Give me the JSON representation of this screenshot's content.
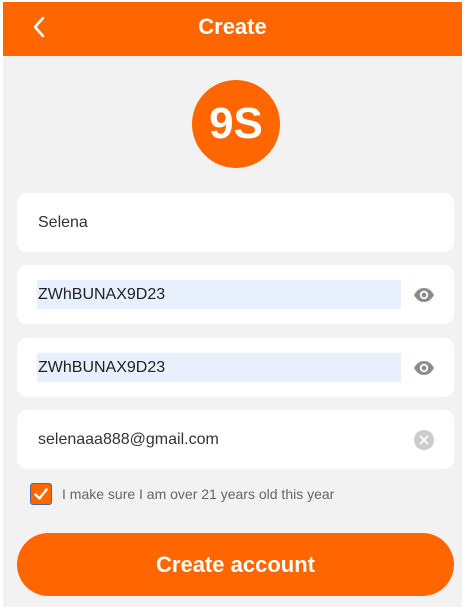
{
  "header": {
    "title": "Create",
    "back_icon": "chevron-left-icon"
  },
  "logo": {
    "text": "9S"
  },
  "form": {
    "username": "Selena",
    "password": "ZWhBUNAX9D23",
    "confirm_password": "ZWhBUNAX9D23",
    "email": "selenaaa888@gmail.com",
    "agree_checked": true,
    "agree_label": "I make sure I am over 21 years old this year"
  },
  "actions": {
    "create_label": "Create account"
  },
  "colors": {
    "accent": "#ff6600",
    "background": "#f2f2f2",
    "autofill": "#e8f0fe",
    "icon_gray": "#999999"
  }
}
